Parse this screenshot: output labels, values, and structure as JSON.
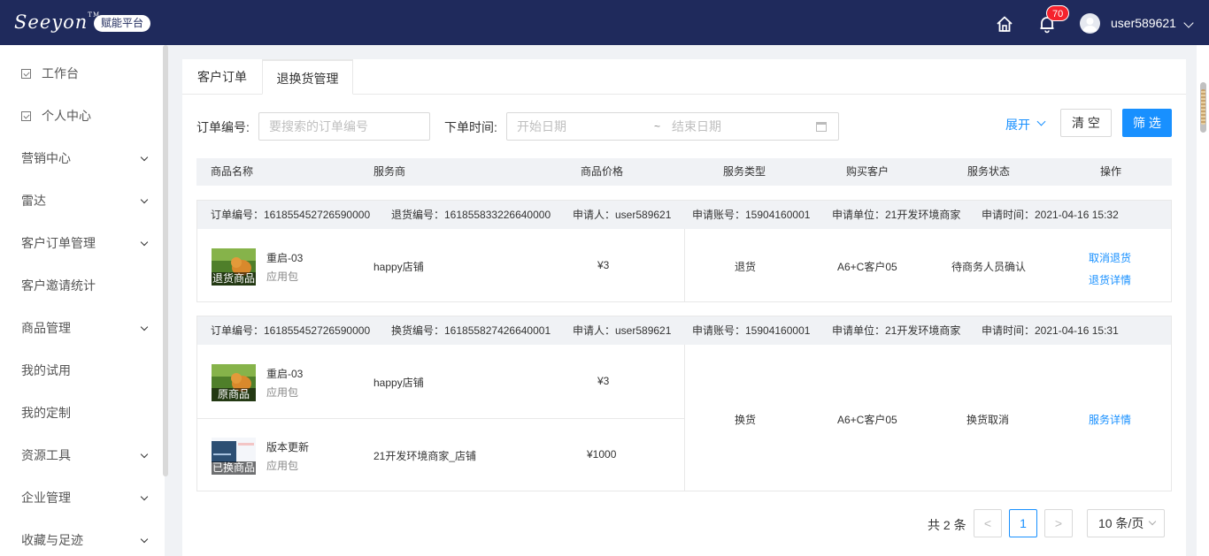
{
  "header": {
    "logo": "Seeyon",
    "logo_tm": "TM",
    "platform_badge": "赋能平台",
    "notification_count": "70",
    "username": "user589621"
  },
  "sidebar": {
    "items": [
      {
        "label": "工作台",
        "icon": "workbench-icon",
        "expandable": false
      },
      {
        "label": "个人中心",
        "icon": "personal-icon",
        "expandable": false
      },
      {
        "label": "营销中心",
        "expandable": true
      },
      {
        "label": "雷达",
        "expandable": true
      },
      {
        "label": "客户订单管理",
        "expandable": true
      },
      {
        "label": "客户邀请统计",
        "expandable": false
      },
      {
        "label": "商品管理",
        "expandable": true
      },
      {
        "label": "我的试用",
        "expandable": false
      },
      {
        "label": "我的定制",
        "expandable": false
      },
      {
        "label": "资源工具",
        "expandable": true
      },
      {
        "label": "企业管理",
        "expandable": true
      },
      {
        "label": "收藏与足迹",
        "expandable": true
      }
    ]
  },
  "tabs": [
    {
      "label": "客户订单",
      "active": false
    },
    {
      "label": "退换货管理",
      "active": true
    }
  ],
  "filters": {
    "order_no_label": "订单编号:",
    "order_no_placeholder": "要搜索的订单编号",
    "order_time_label": "下单时间:",
    "start_date_placeholder": "开始日期",
    "date_separator": "~",
    "end_date_placeholder": "结束日期",
    "expand_label": "展开",
    "clear_label": "清 空",
    "filter_label": "筛 选"
  },
  "table": {
    "columns": [
      "商品名称",
      "服务商",
      "商品价格",
      "服务类型",
      "购买客户",
      "服务状态",
      "操作"
    ]
  },
  "orders": [
    {
      "order_no": "订单编号：161855452726590000",
      "service_no": "退货编号：161855833226640000",
      "applicant": "申请人：user589621",
      "account": "申请账号：15904160001",
      "unit": "申请单位：21开发环境商家",
      "time": "申请时间：2021-04-16 15:32",
      "products": [
        {
          "tag": "退货商品",
          "name": "重启-03",
          "type": "应用包",
          "provider": "happy店铺",
          "price": "¥3"
        }
      ],
      "service_type": "退货",
      "customer": "A6+C客户05",
      "status": "待商务人员确认",
      "actions": [
        "取消退货",
        "退货详情"
      ]
    },
    {
      "order_no": "订单编号：161855452726590000",
      "service_no": "换货编号：161855827426640001",
      "applicant": "申请人：user589621",
      "account": "申请账号：15904160001",
      "unit": "申请单位：21开发环境商家",
      "time": "申请时间：2021-04-16 15:31",
      "products": [
        {
          "tag": "原商品",
          "name": "重启-03",
          "type": "应用包",
          "provider": "happy店铺",
          "price": "¥3"
        },
        {
          "tag": "已换商品",
          "name": "版本更新",
          "type": "应用包",
          "provider": "21开发环境商家_店铺",
          "price": "¥1000"
        }
      ],
      "service_type": "换货",
      "customer": "A6+C客户05",
      "status": "换货取消",
      "actions": [
        "服务详情"
      ]
    }
  ],
  "pagination": {
    "total": "共 2 条",
    "prev": "<",
    "current": "1",
    "next": ">",
    "page_size": "10 条/页"
  }
}
